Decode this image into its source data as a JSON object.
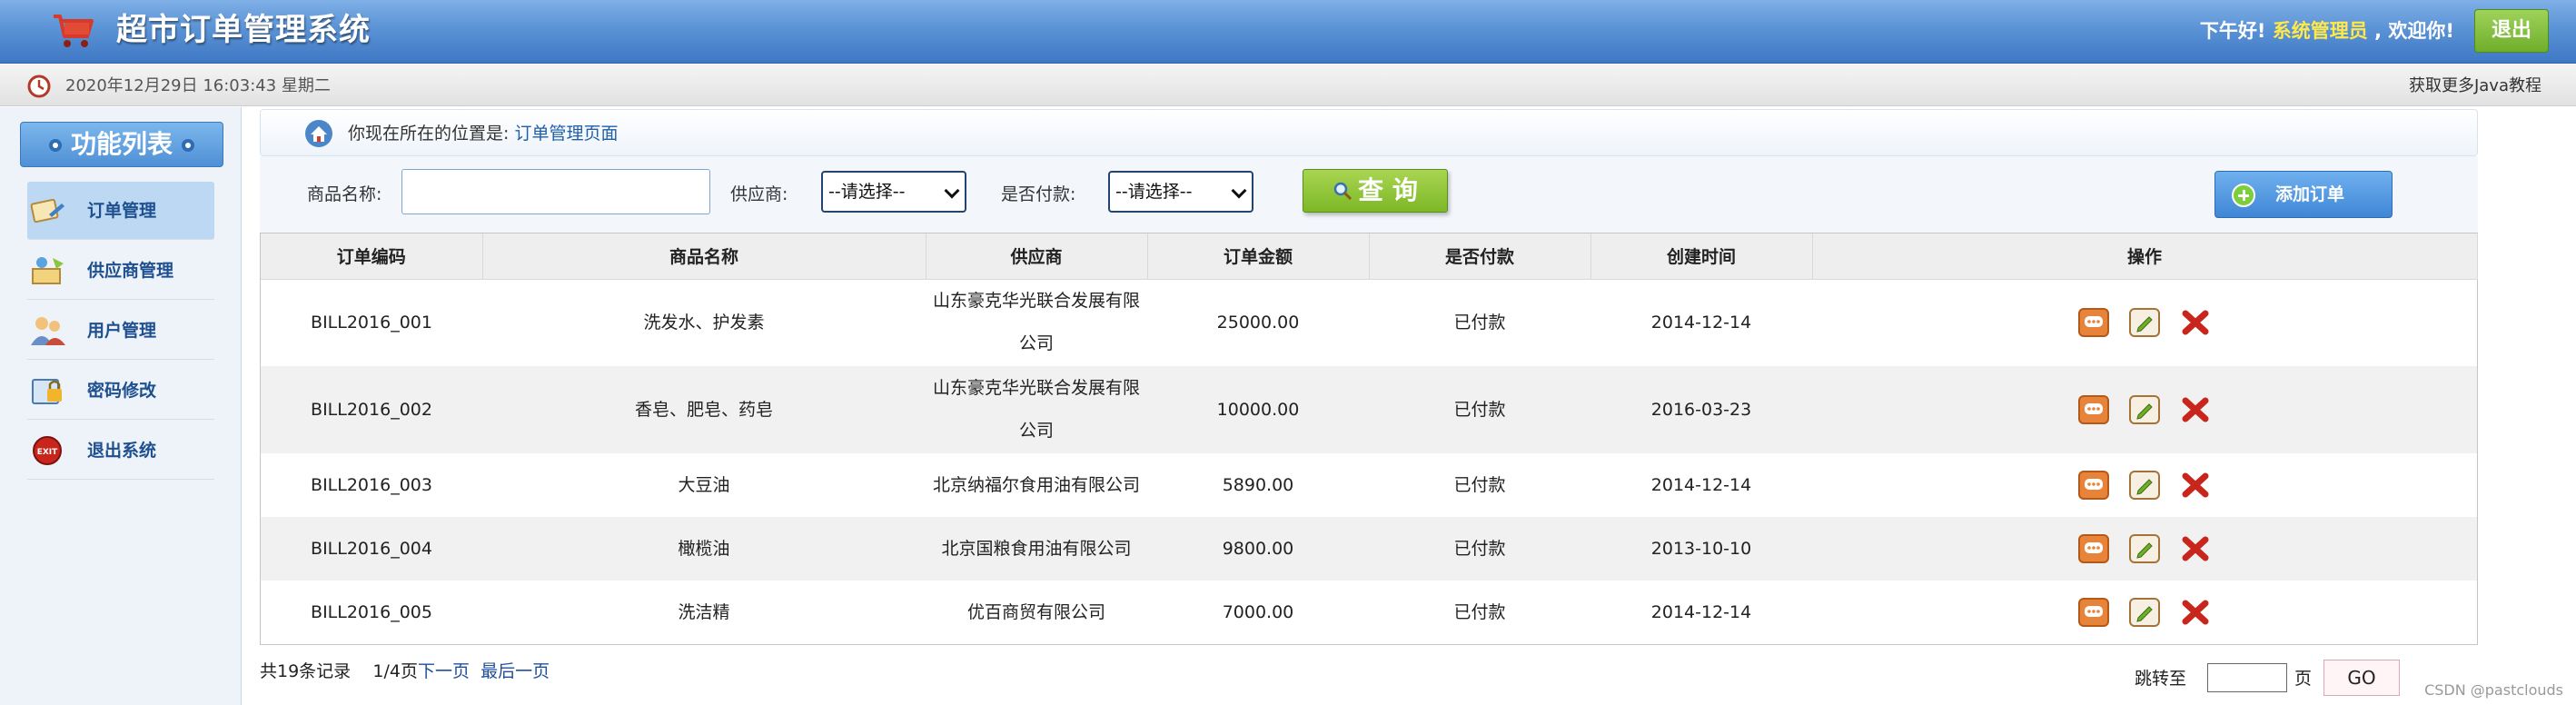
{
  "header": {
    "title": "超市订单管理系统",
    "greeting_prefix": "下午好!",
    "user_role": "系统管理员",
    "greeting_suffix": ", 欢迎你!",
    "logout_label": "退出"
  },
  "infobar": {
    "datetime": "2020年12月29日 16:03:43 星期二",
    "java_link": "获取更多Java教程"
  },
  "sidebar": {
    "title": "功能列表",
    "items": [
      {
        "label": "订单管理",
        "icon": "order-icon",
        "active": true
      },
      {
        "label": "供应商管理",
        "icon": "provider-icon",
        "active": false
      },
      {
        "label": "用户管理",
        "icon": "users-icon",
        "active": false
      },
      {
        "label": "密码修改",
        "icon": "password-icon",
        "active": false
      },
      {
        "label": "退出系统",
        "icon": "exit-icon",
        "active": false
      }
    ]
  },
  "breadcrumb": {
    "prefix": "你现在所在的位置是:",
    "current": "订单管理页面"
  },
  "search": {
    "product_label": "商品名称:",
    "product_value": "",
    "provider_label": "供应商:",
    "provider_selected": "--请选择--",
    "paid_label": "是否付款:",
    "paid_selected": "--请选择--",
    "query_label": "查 询",
    "add_label": "添加订单"
  },
  "table": {
    "columns": [
      "订单编码",
      "商品名称",
      "供应商",
      "订单金额",
      "是否付款",
      "创建时间",
      "操作"
    ],
    "rows": [
      {
        "code": "BILL2016_001",
        "product": "洗发水、护发素",
        "provider_line1": "山东豪克华光联合发展有限",
        "provider_line2": "公司",
        "amount": "25000.00",
        "paid": "已付款",
        "created": "2014-12-14"
      },
      {
        "code": "BILL2016_002",
        "product": "香皂、肥皂、药皂",
        "provider_line1": "山东豪克华光联合发展有限",
        "provider_line2": "公司",
        "amount": "10000.00",
        "paid": "已付款",
        "created": "2016-03-23"
      },
      {
        "code": "BILL2016_003",
        "product": "大豆油",
        "provider_line1": "北京纳福尔食用油有限公司",
        "provider_line2": "",
        "amount": "5890.00",
        "paid": "已付款",
        "created": "2014-12-14"
      },
      {
        "code": "BILL2016_004",
        "product": "橄榄油",
        "provider_line1": "北京国粮食用油有限公司",
        "provider_line2": "",
        "amount": "9800.00",
        "paid": "已付款",
        "created": "2013-10-10"
      },
      {
        "code": "BILL2016_005",
        "product": "洗洁精",
        "provider_line1": "优百商贸有限公司",
        "provider_line2": "",
        "amount": "7000.00",
        "paid": "已付款",
        "created": "2014-12-14"
      }
    ]
  },
  "pagination": {
    "total": "共19条记录",
    "page": "1/4页",
    "next": "下一页",
    "last": "最后一页",
    "jump_label": "跳转至",
    "page_unit": "页",
    "go_label": "GO"
  },
  "watermark": "CSDN @pastclouds",
  "colors": {
    "header_blue": "#5b93d6",
    "accent_green": "#7cb826",
    "link_blue": "#1f5fa8",
    "greeting_yellow": "#ffe84a"
  }
}
